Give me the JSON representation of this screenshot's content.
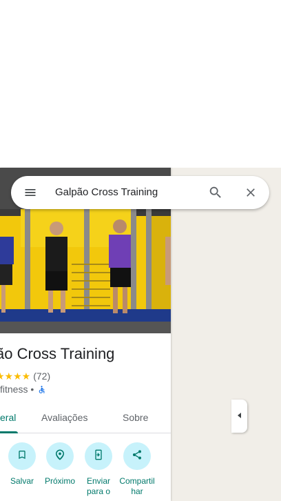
{
  "search": {
    "query": "Galpão Cross Training"
  },
  "place": {
    "name": "ão Cross Training",
    "stars": "★★★★",
    "review_count": "(72)",
    "category": "fitness •"
  },
  "tabs": [
    {
      "label": "eral",
      "active": true
    },
    {
      "label": "Avaliações",
      "active": false
    },
    {
      "label": "Sobre",
      "active": false
    }
  ],
  "actions": [
    {
      "label": "Salvar",
      "icon": "bookmark-icon"
    },
    {
      "label": "Próximo",
      "icon": "nearby-icon"
    },
    {
      "label": "Enviar para o",
      "icon": "send-to-phone-icon"
    },
    {
      "label": "Compartilhar",
      "icon": "share-icon"
    }
  ],
  "colors": {
    "accent": "#00796b",
    "action_bg": "#c7f2fb",
    "star": "#fbbc04",
    "map_bg": "#f1eee8"
  }
}
